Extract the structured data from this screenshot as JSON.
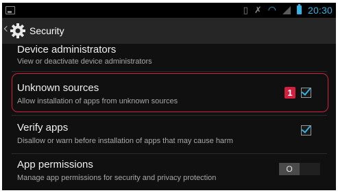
{
  "status_bar": {
    "time": "20:30",
    "icons": [
      "notification-icon",
      "vibrate-icon",
      "wifi-icon",
      "signal-icon",
      "battery-icon"
    ]
  },
  "action_bar": {
    "title": "Security",
    "icon": "gear-icon"
  },
  "settings": [
    {
      "title": "Device administrators",
      "summary": "View or deactivate device administrators",
      "control": "none"
    },
    {
      "title": "Unknown sources",
      "summary": "Allow installation of apps from unknown sources",
      "control": "checkbox",
      "checked": true,
      "annotation": "1"
    },
    {
      "title": "Verify apps",
      "summary": "Disallow or warn before installation of apps that may cause harm",
      "control": "checkbox",
      "checked": true
    },
    {
      "title": "App permissions",
      "summary": "Manage app permissions for security and privacy protection",
      "control": "toggle",
      "toggle_label": "O"
    }
  ],
  "colors": {
    "accent": "#33b5e5",
    "annotation": "#d3203f",
    "background": "#101010"
  }
}
